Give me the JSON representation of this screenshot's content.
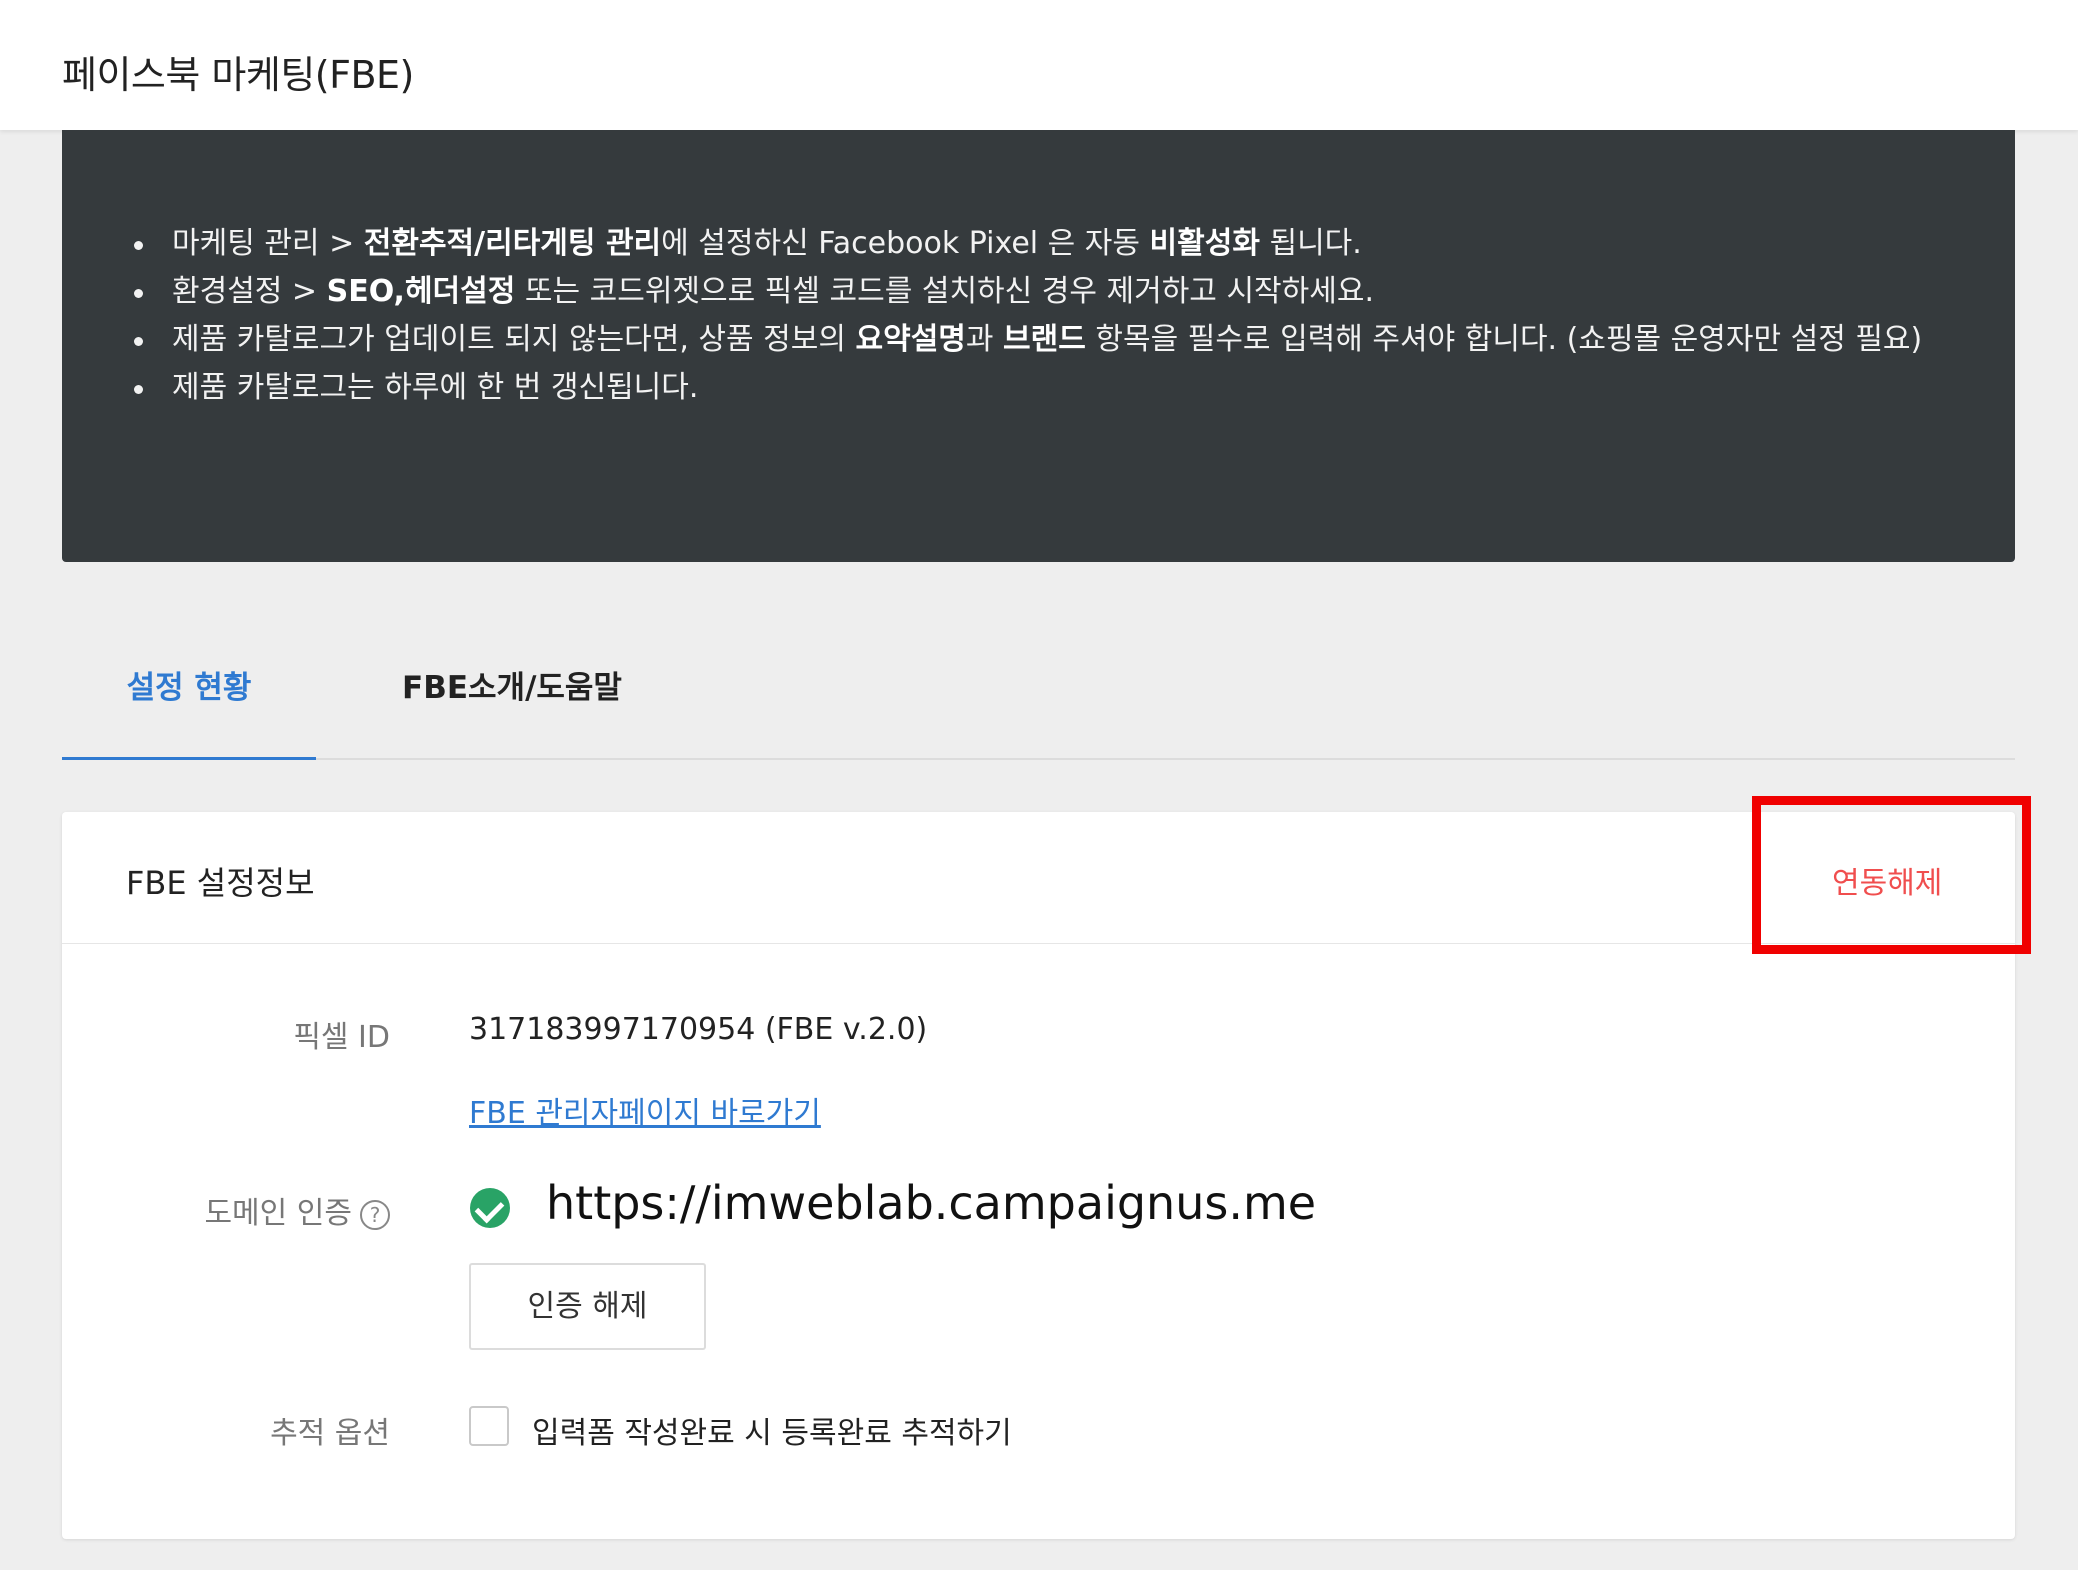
{
  "page": {
    "title": "페이스북 마케팅(FBE)"
  },
  "notice": {
    "items": [
      {
        "parts": [
          {
            "text": "마케팅 관리 > ",
            "bold": false
          },
          {
            "text": "전환추적/리타게팅 관리",
            "bold": true
          },
          {
            "text": "에 설정하신 Facebook Pixel 은 자동 ",
            "bold": false
          },
          {
            "text": "비활성화",
            "bold": true
          },
          {
            "text": " 됩니다.",
            "bold": false
          }
        ]
      },
      {
        "parts": [
          {
            "text": "환경설정 > ",
            "bold": false
          },
          {
            "text": "SEO,헤더설정",
            "bold": true
          },
          {
            "text": " 또는 코드위젯으로 픽셀 코드를 설치하신 경우 제거하고 시작하세요.",
            "bold": false
          }
        ]
      },
      {
        "parts": [
          {
            "text": "제품 카탈로그가 업데이트 되지 않는다면, 상품 정보의 ",
            "bold": false
          },
          {
            "text": "요약설명",
            "bold": true
          },
          {
            "text": "과 ",
            "bold": false
          },
          {
            "text": "브랜드",
            "bold": true
          },
          {
            "text": " 항목을 필수로 입력해 주셔야 합니다. (쇼핑몰 운영자만 설정 필요)",
            "bold": false
          }
        ]
      },
      {
        "parts": [
          {
            "text": "제품 카탈로그는 하루에 한 번 갱신됩니다.",
            "bold": false
          }
        ]
      }
    ]
  },
  "tabs": [
    {
      "label": "설정 현황",
      "active": true
    },
    {
      "label": "FBE소개/도움말",
      "active": false
    }
  ],
  "card": {
    "title": "FBE 설정정보",
    "unlink_label": "연동해제",
    "pixel": {
      "label": "픽셀 ID",
      "value": "317183997170954 (FBE v.2.0)",
      "admin_link": "FBE 관리자페이지 바로가기"
    },
    "domain": {
      "label": "도메인 인증",
      "help_icon": "?",
      "url": "https://imweblab.campaignus.me",
      "verified": true,
      "revoke_label": "인증 해제"
    },
    "tracking": {
      "label": "추적 옵션",
      "checkbox_label": "입력폼 작성완료 시 등록완료 추적하기",
      "checked": false
    }
  },
  "colors": {
    "accent": "#2f7ad1",
    "danger": "#f04e4e",
    "highlight": "#f00000",
    "success": "#29a366",
    "notice_bg": "#353a3d"
  }
}
